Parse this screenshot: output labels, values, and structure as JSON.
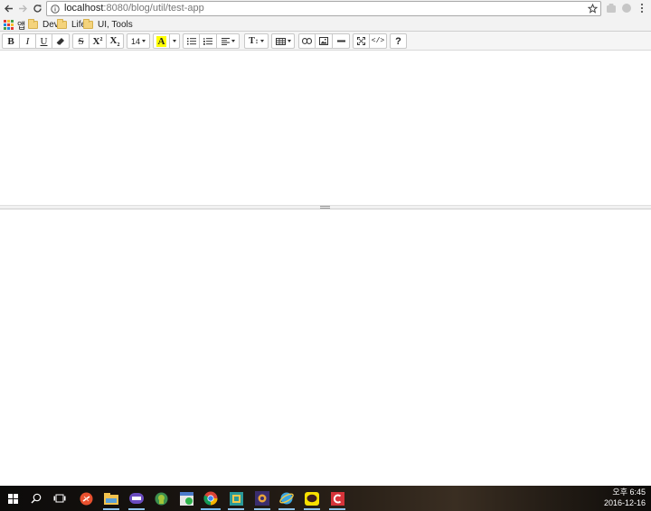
{
  "browser": {
    "url_host": "localhost",
    "url_rest": ":8080/blog/util/test-app",
    "icons": [
      "back-icon",
      "forward-icon",
      "reload-icon",
      "info-icon",
      "bookmark-star-icon",
      "extension-icon",
      "profile-icon",
      "menu-icon"
    ]
  },
  "bookmarks": {
    "apps_label": "앱",
    "items": [
      {
        "label": "Dev."
      },
      {
        "label": "Life"
      },
      {
        "label": "UI, Tools"
      }
    ]
  },
  "toolbar": {
    "bold": "B",
    "italic": "I",
    "underline": "U",
    "strike": "S",
    "superscript": "X",
    "superscript_mark": "2",
    "subscript": "X",
    "subscript_mark": "2",
    "font_size": "14",
    "highlight": "A",
    "text_style": "T",
    "help": "?",
    "code_view": "</>",
    "accent_highlight": "#ffff00"
  },
  "taskbar": {
    "apps": [
      "start-icon",
      "search-icon",
      "task-view-icon",
      "app-orange-icon",
      "file-explorer-icon",
      "app-purple-icon",
      "app-android-icon",
      "app-green-icon",
      "chrome-icon",
      "app-box-icon",
      "app-dark-icon",
      "app-globe-icon",
      "kakaotalk-icon",
      "app-red-icon"
    ],
    "time": "오후 6:45",
    "date": "2016-12-16"
  }
}
